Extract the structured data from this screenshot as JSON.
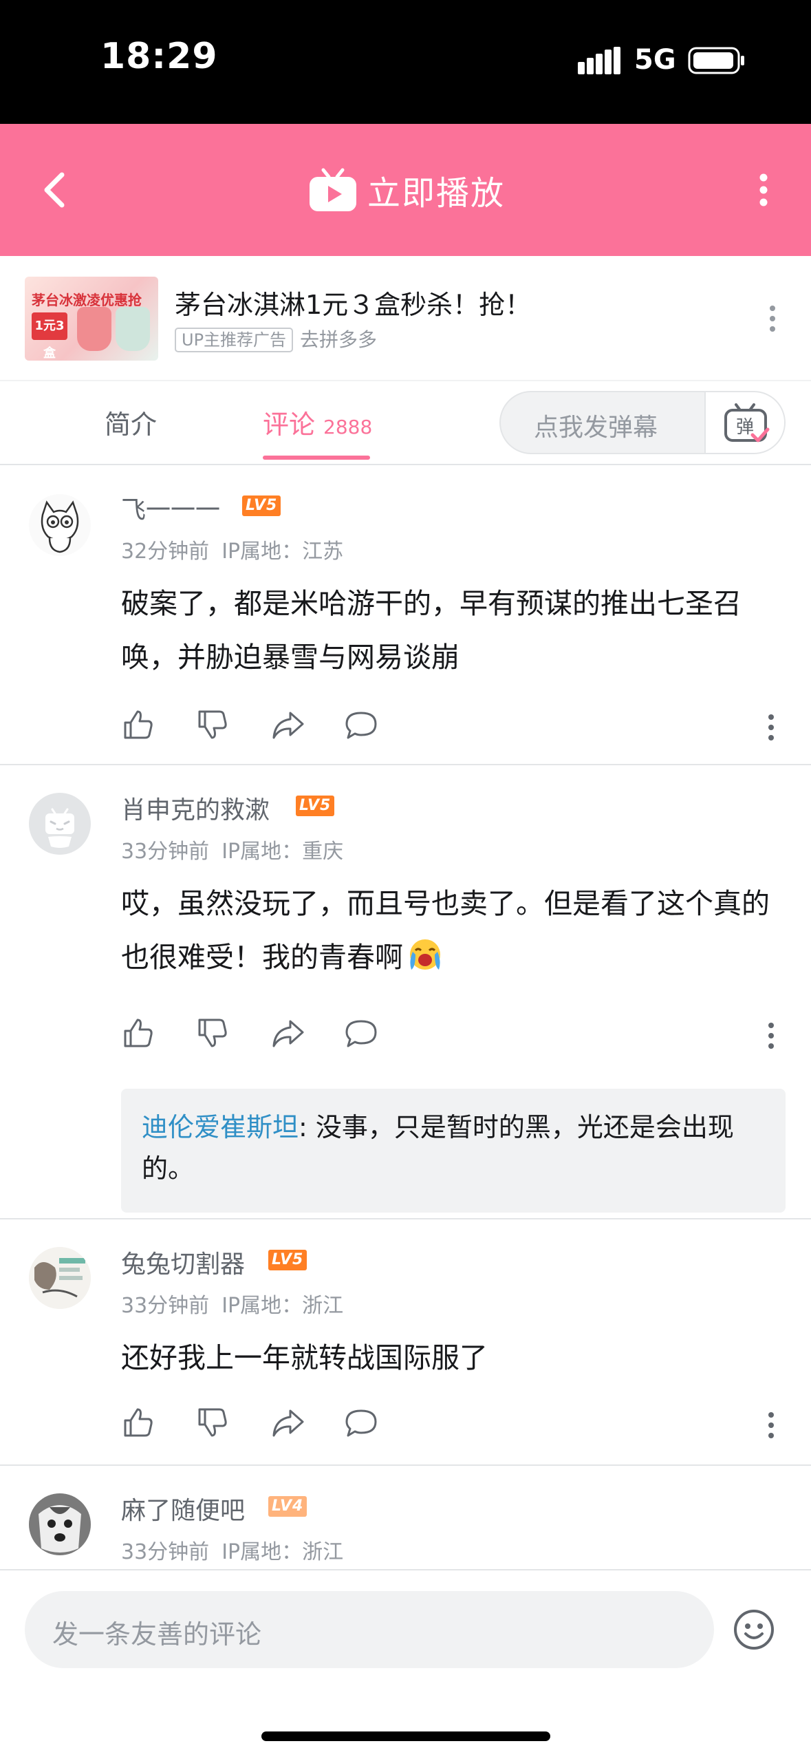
{
  "status_bar": {
    "time": "18:29",
    "network": "5G"
  },
  "header": {
    "title": "立即播放"
  },
  "ad": {
    "title": "茅台冰淇淋1元３盒秒杀！抢！",
    "tag": "UP主推荐广告",
    "source": "去拼多多",
    "thumb_text": "茅台冰激凌优惠抢",
    "thumb_badge": "1元3盒"
  },
  "tabs": {
    "intro": "简介",
    "comments": "评论",
    "comments_count": "2888",
    "danmaku_placeholder": "点我发弹幕",
    "danmaku_toggle_label": "弹"
  },
  "comments": [
    {
      "username": "飞一一一",
      "level": "LV5",
      "time": "32分钟前",
      "ip": "IP属地：江苏",
      "content": "破案了，都是米哈游干的，早有预谋的推出七圣召唤，并胁迫暴雪与网易谈崩"
    },
    {
      "username": "肖申克的救漱",
      "level": "LV5",
      "time": "33分钟前",
      "ip": "IP属地：重庆",
      "content": "哎，虽然没玩了，而且号也卖了。但是看了这个真的也很难受！我的青春啊",
      "reply": {
        "user": "迪伦爱崔斯坦",
        "sep": ": ",
        "text": "没事，只是暂时的黑，光还是会出现的。"
      }
    },
    {
      "username": "兔兔切割器",
      "level": "LV5",
      "time": "33分钟前",
      "ip": "IP属地：浙江",
      "content": "还好我上一年就转战国际服了"
    },
    {
      "username": "麻了随便吧",
      "level": "LV4",
      "time": "33分钟前",
      "ip": "IP属地：浙江"
    }
  ],
  "input": {
    "placeholder": "发一条友善的评论"
  },
  "colors": {
    "brand_pink": "#fb7299",
    "link_blue": "#2f8fc6",
    "level5": "#ff7f24",
    "level4": "#ffb37c"
  }
}
